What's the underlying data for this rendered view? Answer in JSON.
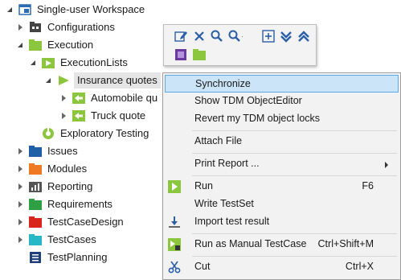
{
  "tree": {
    "root": "Single-user Workspace",
    "configurations": "Configurations",
    "execution": "Execution",
    "execution_lists": "ExecutionLists",
    "insurance_quotes": "Insurance quotes",
    "automobile": "Automobile qu",
    "truck": "Truck quote",
    "exploratory": "Exploratory Testing",
    "issues": "Issues",
    "modules": "Modules",
    "reporting": "Reporting",
    "requirements": "Requirements",
    "testcasedesign": "TestCaseDesign",
    "testcases": "TestCases",
    "testplanning": "TestPlanning"
  },
  "menu": {
    "synchronize": "Synchronize",
    "show_editor": "Show TDM ObjectEditor",
    "revert_locks": "Revert my TDM object locks",
    "attach_file": "Attach File",
    "print_report": "Print Report ...",
    "run": "Run",
    "run_shortcut": "F6",
    "write_testset": "Write TestSet",
    "import_result": "Import test result",
    "run_manual": "Run as Manual TestCase",
    "run_manual_shortcut": "Ctrl+Shift+M",
    "cut": "Cut",
    "cut_shortcut": "Ctrl+X"
  },
  "colors": {
    "issues": "#1f5fa8",
    "modules": "#f07a22",
    "requirements": "#2ea043",
    "testcasedesign": "#d9261c",
    "testcases": "#27b7c6",
    "execution_green": "#8cc63f",
    "menu_highlight": "#cce4f7"
  },
  "icons": {
    "workspace": "workspace-icon",
    "toolbar": [
      "edit-icon",
      "delete-icon",
      "search-icon",
      "search-dropdown-icon",
      "add-icon",
      "collapse-all-icon",
      "expand-all-icon",
      "stop-icon",
      "folder-icon"
    ]
  }
}
